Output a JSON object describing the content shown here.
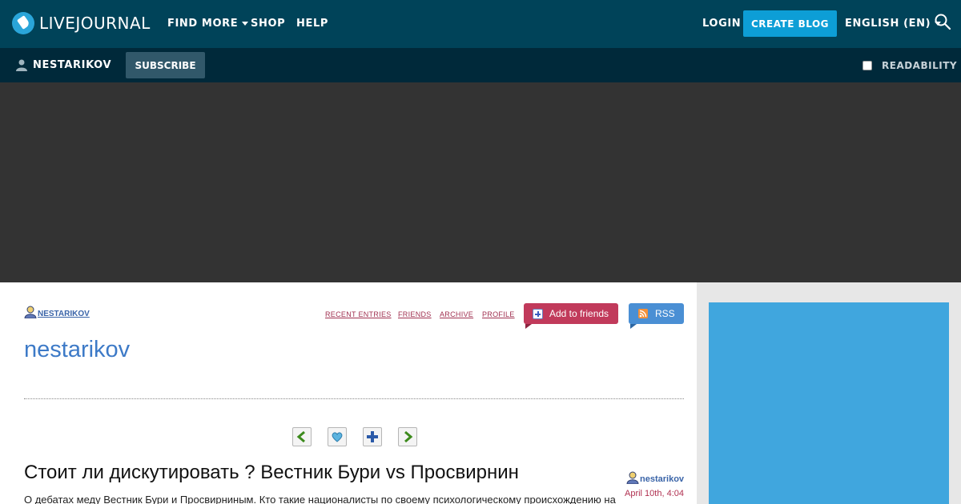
{
  "topbar": {
    "logo_text": "LIVEJOURNAL",
    "nav": {
      "find_more": "FIND MORE",
      "shop": "SHOP",
      "help": "HELP"
    },
    "login": "LOGIN",
    "create_blog": "CREATE BLOG",
    "language": "ENGLISH (EN)"
  },
  "journal_bar": {
    "username": "NESTARIKOV",
    "subscribe": "SUBSCRIBE",
    "readability": "READABILITY",
    "readability_checked": false
  },
  "header": {
    "author": "nestarikov",
    "links": {
      "recent_entries": "RECENT ENTRIES",
      "friends": "FRIENDS",
      "archive": "ARCHIVE",
      "profile": "PROFILE"
    },
    "add_to_friends": "Add to friends",
    "rss": "RSS",
    "journal_title": "nestarikov"
  },
  "entry_nav": [
    "previous-entry-icon",
    "memories-icon",
    "add-icon",
    "next-entry-icon"
  ],
  "post": {
    "title": "Стоит ли дискутировать ? Вестник Бури vs Просвирнин",
    "author": "nestarikov",
    "date": "April 10th, 4:04",
    "excerpt": "О дебатах меду Вестник Бури и Просвирниным. Кто такие националисты по своему психологическому происхождению на"
  },
  "colors": {
    "topbar_bg": "#004359",
    "journal_bar_bg": "#00293a",
    "create_blog_bg": "#0d9ed6",
    "add_friends_bg": "#c13a5b",
    "rss_bg": "#4a8fd4",
    "title_blue": "#3d7ac7",
    "sidebar_ad_bg": "#40a6de"
  }
}
